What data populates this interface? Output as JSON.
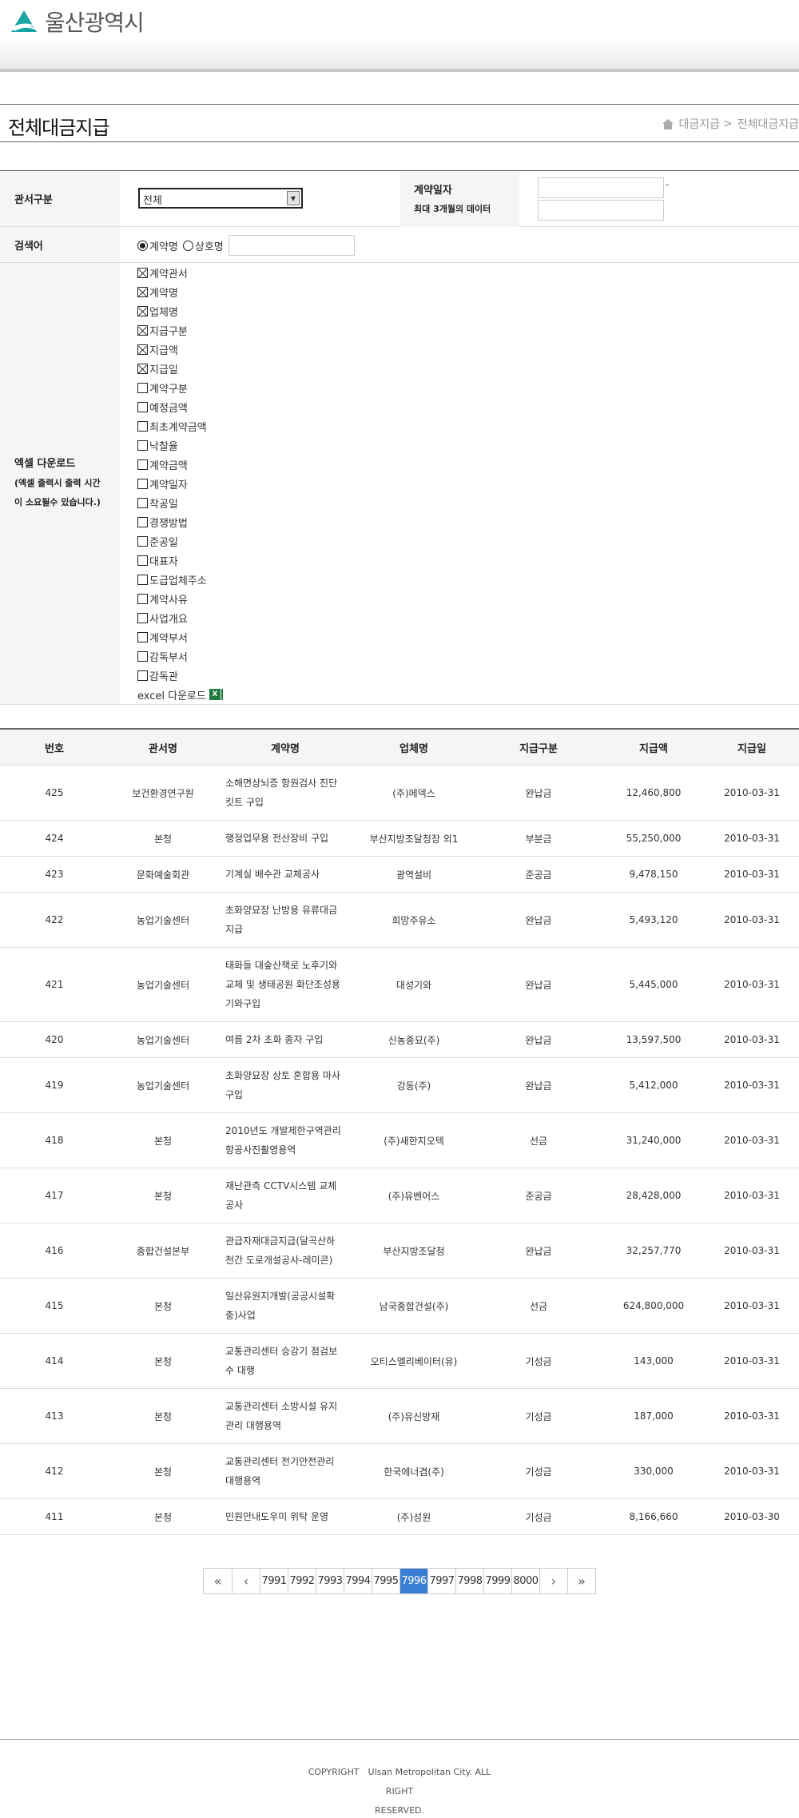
{
  "header": {
    "logo_text": "울산광역시"
  },
  "title": {
    "heading": "전체대금지급",
    "breadcrumb": [
      "대금지급",
      "전체대금지급"
    ],
    "breadcrumb_sep": ">"
  },
  "form": {
    "office_label": "관서구분",
    "office_value": "전체",
    "date_label": "계약일자",
    "date_note": "최대 3개월의 데이터",
    "date_sep": "-",
    "keyword_label": "검색어",
    "radio_contract": "계약명",
    "radio_company": "상호명",
    "excel_label_1": "엑셀 다운로드",
    "excel_label_2": "(엑셀 출력시 출력 시간",
    "excel_label_3": "이 소요될수 있습니다.)",
    "columns": [
      {
        "label": "계약관서",
        "checked": true
      },
      {
        "label": "계약명",
        "checked": true
      },
      {
        "label": "업체명",
        "checked": true
      },
      {
        "label": "지급구분",
        "checked": true
      },
      {
        "label": "지급액",
        "checked": true
      },
      {
        "label": "지급일",
        "checked": true
      },
      {
        "label": "계약구분",
        "checked": false
      },
      {
        "label": "예정금액",
        "checked": false
      },
      {
        "label": "최초계약금액",
        "checked": false
      },
      {
        "label": "낙찰율",
        "checked": false
      },
      {
        "label": "계약금액",
        "checked": false
      },
      {
        "label": "계약일자",
        "checked": false
      },
      {
        "label": "착공일",
        "checked": false
      },
      {
        "label": "경쟁방법",
        "checked": false
      },
      {
        "label": "준공일",
        "checked": false
      },
      {
        "label": "대표자",
        "checked": false
      },
      {
        "label": "도급업체주소",
        "checked": false
      },
      {
        "label": "계약사유",
        "checked": false
      },
      {
        "label": "사업개요",
        "checked": false
      },
      {
        "label": "계약부서",
        "checked": false
      },
      {
        "label": "감독부서",
        "checked": false
      },
      {
        "label": "감독관",
        "checked": false
      }
    ],
    "excel_download": "excel 다운로드",
    "excel_icon": "X"
  },
  "table": {
    "headers": [
      "번호",
      "관서명",
      "계약명",
      "업체명",
      "지급구분",
      "지급액",
      "지급일"
    ],
    "rows": [
      {
        "no": "425",
        "office": "보건환경연구원",
        "lines": [
          "소해면상뇌증 항원검사 진단",
          "킷트 구입"
        ],
        "company": "(주)메덱스",
        "type": "완납금",
        "amount": "12,460,800",
        "date": "2010-03-31"
      },
      {
        "no": "424",
        "office": "본청",
        "lines": [
          "행정업무용 전산장비 구입"
        ],
        "company": "부산지방조달청장 외1",
        "type": "부분금",
        "amount": "55,250,000",
        "date": "2010-03-31"
      },
      {
        "no": "423",
        "office": "문화예술회관",
        "lines": [
          "기계실 배수관 교체공사"
        ],
        "company": "광역설비",
        "type": "준공금",
        "amount": "9,478,150",
        "date": "2010-03-31"
      },
      {
        "no": "422",
        "office": "농업기술센터",
        "lines": [
          "초화양묘장 난방용 유류대금",
          "지급"
        ],
        "company": "희망주유소",
        "type": "완납금",
        "amount": "5,493,120",
        "date": "2010-03-31"
      },
      {
        "no": "421",
        "office": "농업기술센터",
        "lines": [
          "태화들 대숲산책로 노후기와",
          "교체 및 생태공원 화단조성용",
          "기와구입"
        ],
        "company": "대성기와",
        "type": "완납금",
        "amount": "5,445,000",
        "date": "2010-03-31"
      },
      {
        "no": "420",
        "office": "농업기술센터",
        "lines": [
          "여름 2차 초화 종자 구입"
        ],
        "company": "신농종묘(주)",
        "type": "완납금",
        "amount": "13,597,500",
        "date": "2010-03-31"
      },
      {
        "no": "419",
        "office": "농업기술센터",
        "lines": [
          "초화양묘장 상토 혼합용 마사",
          "구입"
        ],
        "company": "강동(주)",
        "type": "완납금",
        "amount": "5,412,000",
        "date": "2010-03-31"
      },
      {
        "no": "418",
        "office": "본청",
        "lines": [
          "2010년도 개발제한구역관리",
          "항공사진촬영용역"
        ],
        "company": "(주)새한지오텍",
        "type": "선금",
        "amount": "31,240,000",
        "date": "2010-03-31"
      },
      {
        "no": "417",
        "office": "본청",
        "lines": [
          "재난관측 CCTV시스템 교체",
          "공사"
        ],
        "company": "(주)유벤어스",
        "type": "준공금",
        "amount": "28,428,000",
        "date": "2010-03-31"
      },
      {
        "no": "416",
        "office": "종합건설본부",
        "lines": [
          "관급자재대금지급(달곡산하",
          "천간 도로개설공사-레미콘)"
        ],
        "company": "부산지방조달청",
        "type": "완납금",
        "amount": "32,257,770",
        "date": "2010-03-31"
      },
      {
        "no": "415",
        "office": "본청",
        "lines": [
          "일산유원지개발(공공시설확",
          "충)사업"
        ],
        "company": "남국종합건설(주)",
        "type": "선금",
        "amount": "624,800,000",
        "date": "2010-03-31"
      },
      {
        "no": "414",
        "office": "본청",
        "lines": [
          "교통관리센터 승강기 점검보",
          "수 대행"
        ],
        "company": "오티스엘리베이터(유)",
        "type": "기성금",
        "amount": "143,000",
        "date": "2010-03-31"
      },
      {
        "no": "413",
        "office": "본청",
        "lines": [
          "교통관리센터 소방시설 유지",
          "관리 대행용역"
        ],
        "company": "(주)유신방재",
        "type": "기성금",
        "amount": "187,000",
        "date": "2010-03-31"
      },
      {
        "no": "412",
        "office": "본청",
        "lines": [
          "교통관리센터 전기안전관리",
          "대행용역"
        ],
        "company": "한국에너겸(주)",
        "type": "기성금",
        "amount": "330,000",
        "date": "2010-03-31"
      },
      {
        "no": "411",
        "office": "본청",
        "lines": [
          "민원안내도우미 위탁 운영"
        ],
        "company": "(주)성원",
        "type": "기성금",
        "amount": "8,166,660",
        "date": "2010-03-30"
      }
    ]
  },
  "pager": {
    "first": "«",
    "prev": "‹",
    "pages": [
      "7991",
      "7992",
      "7993",
      "7994",
      "7995",
      "7996",
      "7997",
      "7998",
      "7999",
      "8000"
    ],
    "current": "7996",
    "next": "›",
    "last": "»"
  },
  "footer": {
    "copyright_1": "COPYRIGHT　Ulsan Metropolitan City. ALL RIGHT",
    "copyright_2": "RESERVED."
  }
}
